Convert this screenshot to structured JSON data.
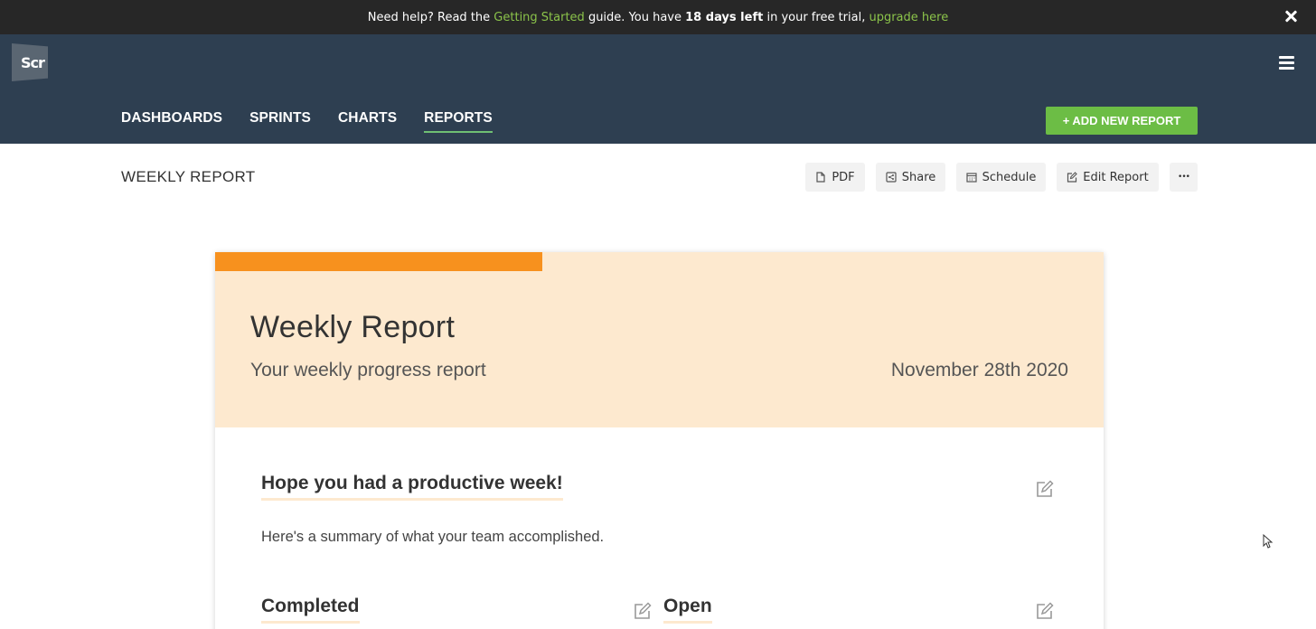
{
  "banner": {
    "text_before": "Need help? Read the ",
    "link_getting_started": "Getting Started",
    "text_mid": " guide. You have ",
    "days_left": "18 days left",
    "text_after": " in your free trial, ",
    "link_upgrade": "upgrade here",
    "link_color": "#8bc34a"
  },
  "header": {
    "logo_text": "Scr",
    "menu_icon": "hamburger-icon",
    "nav": [
      {
        "label": "DASHBOARDS"
      },
      {
        "label": "SPRINTS"
      },
      {
        "label": "CHARTS"
      },
      {
        "label": "REPORTS",
        "active": true
      }
    ],
    "add_button": "+ ADD NEW REPORT",
    "accent_color": "#6cbd45"
  },
  "page": {
    "title": "WEEKLY REPORT"
  },
  "toolbar": {
    "pdf": "PDF",
    "share": "Share",
    "schedule": "Schedule",
    "edit_report": "Edit Report",
    "more": "•••"
  },
  "report": {
    "title": "Weekly Report",
    "subtitle": "Your weekly progress report",
    "date": "November 28th 2020",
    "header_bg": "#fde9cf",
    "accent_bar": "#f7911e",
    "intro_heading": "Hope you had a productive week!",
    "intro_text": "Here's a summary of what your team accomplished.",
    "completed_heading": "Completed",
    "open_heading": "Open"
  }
}
